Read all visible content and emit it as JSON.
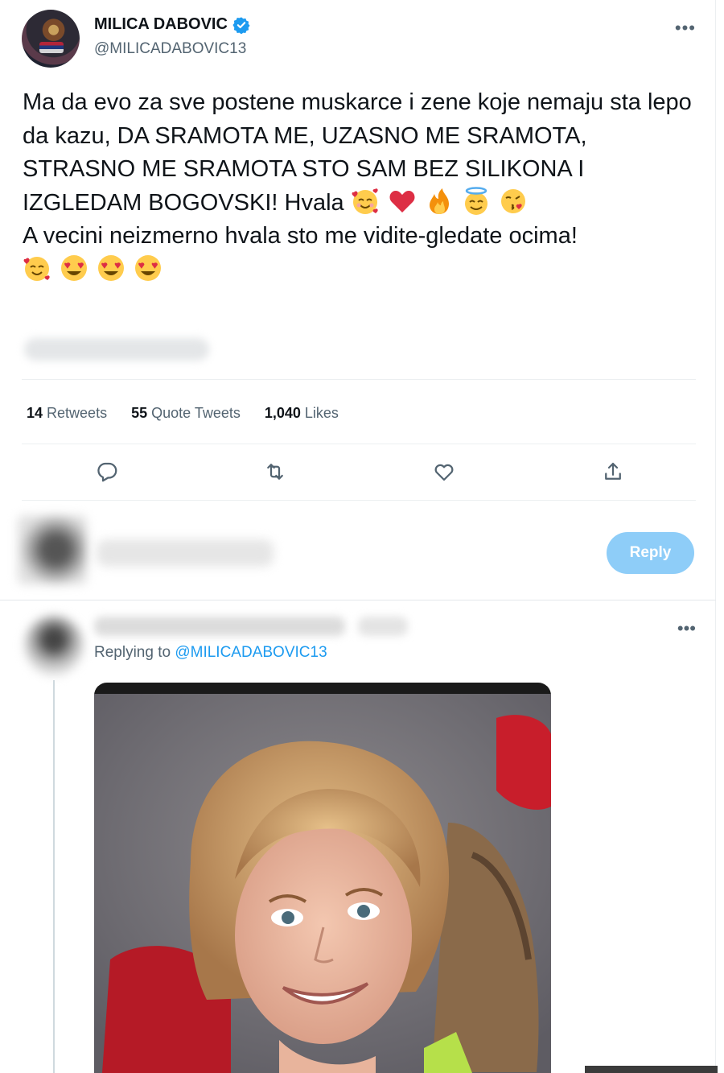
{
  "tweet": {
    "author_name": "MILICA DABOVIC",
    "author_handle": "@MILICADABOVIC13",
    "more_label": "•••",
    "text_line1": "Ma da evo za sve postene muskarce i zene koje nemaju sta lepo da kazu, DA SRAMOTA ME, UZASNO ME SRAMOTA, STRASNO ME SRAMOTA STO SAM BEZ SILIKONA I IZGLEDAM BOGOVSKI! Hvala",
    "text_line1_emojis": [
      "smiling-face-with-hearts",
      "red-heart",
      "fire",
      "smiling-face-with-halo",
      "face-blowing-kiss"
    ],
    "text_line2": "A vecini neizmerno hvala sto me vidite-gledate ocima!",
    "text_line2_emojis": [
      "smiling-face-with-hearts",
      "heart-eyes",
      "heart-eyes",
      "heart-eyes"
    ],
    "stats": {
      "retweets_count": "14",
      "retweets_label": "Retweets",
      "quotes_count": "55",
      "quotes_label": "Quote Tweets",
      "likes_count": "1,040",
      "likes_label": "Likes"
    },
    "actions": [
      "reply-icon",
      "retweet-icon",
      "like-icon",
      "share-icon"
    ]
  },
  "composer": {
    "reply_button_label": "Reply"
  },
  "reply": {
    "more_label": "•••",
    "replying_prefix": "Replying to",
    "replying_mention": "@MILICADABOVIC13"
  },
  "colors": {
    "accent": "#1d9bf0",
    "reply_button_disabled": "#8ecdf8",
    "secondary_text": "#536471"
  }
}
